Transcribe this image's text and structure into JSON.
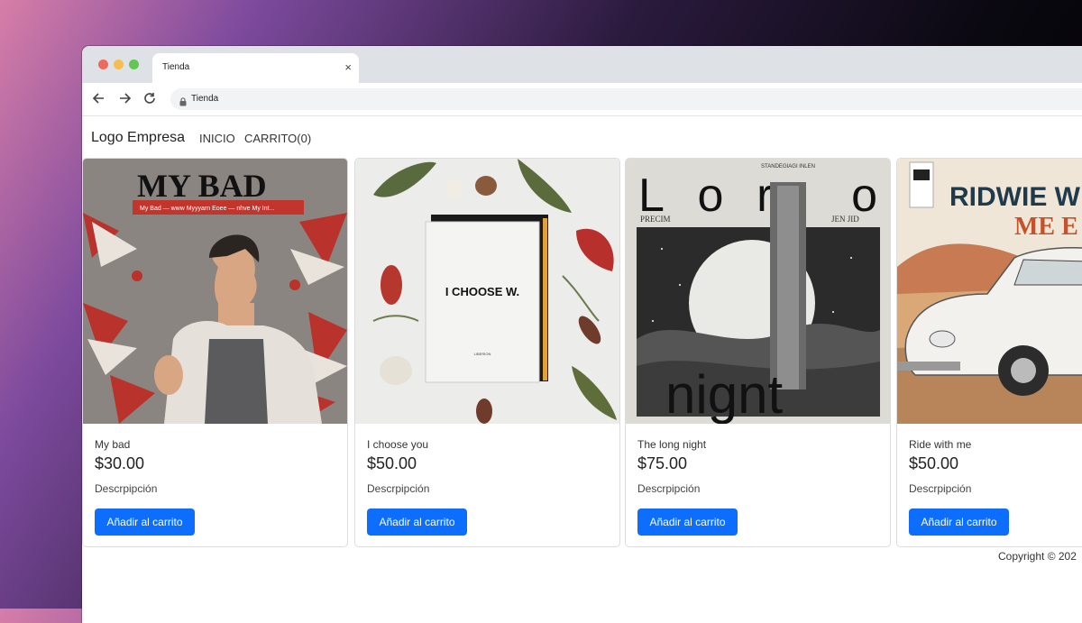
{
  "browser": {
    "tab_title": "Tienda",
    "tab_close": "×",
    "url": "Tienda"
  },
  "site": {
    "brand": "Logo Empresa",
    "nav": {
      "inicio": "INICIO",
      "carrito": "CARRITO(0)"
    },
    "accent_color": "#0d6efd"
  },
  "products": [
    {
      "title": "My bad",
      "price": "$30.00",
      "description": "Descrpipción",
      "button": "Añadir al carrito",
      "cover_text": {
        "headline": "MY BAD",
        "sub": "My Bad — www Myyyarn Eoee — nhve My Int..."
      }
    },
    {
      "title": "I choose you",
      "price": "$50.00",
      "description": "Descrpipción",
      "button": "Añadir al carrito",
      "cover_text": {
        "headline": "I CHOOSE W.",
        "sub": "LIBERION"
      }
    },
    {
      "title": "The long night",
      "price": "$75.00",
      "description": "Descrpipción",
      "button": "Añadir al carrito",
      "cover_text": {
        "top": "STANDEGIAGI INLEN",
        "headline": "Lor o",
        "left": "PRECIM",
        "right": "JEN JID",
        "bottom": "nignt"
      }
    },
    {
      "title": "Ride with me",
      "price": "$50.00",
      "description": "Descrpipción",
      "button": "Añadir al carrito",
      "cover_text": {
        "line1": "RIDWIE W",
        "line2": "ME E"
      }
    }
  ],
  "footer": "Copyright © 202"
}
